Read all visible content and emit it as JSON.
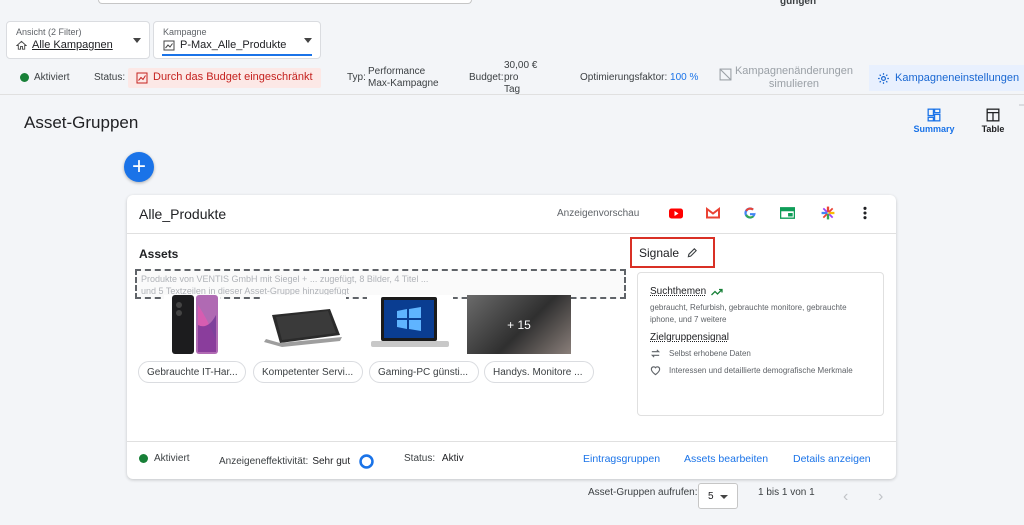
{
  "header": {
    "top_right_fragment": "gungen",
    "view_selector": {
      "label": "Ansicht (2 Filter)",
      "value": "Alle Kampagnen"
    },
    "campaign_selector": {
      "label": "Kampagne",
      "value": "P-Max_Alle_Produkte"
    }
  },
  "status_bar": {
    "state": "Aktiviert",
    "status_label": "Status:",
    "status_value": "Durch das Budget eingeschränkt",
    "type_label": "Typ:",
    "type_value_1": "Performance",
    "type_value_2": "Max-Kampagne",
    "budget_label": "Budget:",
    "budget_value_1": "30,00 €",
    "budget_value_2": "pro",
    "budget_value_3": "Tag",
    "opt_label": "Optimierungsfaktor:",
    "opt_value": "100 %",
    "simulate_1": "Kampagnenänderungen",
    "simulate_2": "simulieren",
    "settings_button": "Kampagneneinstellungen"
  },
  "page": {
    "title": "Asset-Gruppen",
    "view_summary": "Summary",
    "view_table": "Table"
  },
  "card": {
    "title": "Alle_Produkte",
    "preview_label": "Anzeigenvorschau",
    "assets_heading": "Assets",
    "assets_blurred_1": "Produkte von VENTIS GmbH mit Siegel + ... zugefügt, 8 Bilder, 4 Titel ...",
    "assets_blurred_2": "und 5 Textzeilen in dieser Asset-Gruppe hinzugefügt",
    "more_images": "+ 15",
    "chips": [
      "Gebrauchte IT-Har...",
      "Kompetenter Servi...",
      "Gaming-PC günsti...",
      "Handys. Monitore ..."
    ],
    "signals_heading": "Signale",
    "search_themes_heading": "Suchthemen",
    "search_themes_text": "gebraucht, Refurbish, gebrauchte monitore, gebrauchte iphone, und 7 weitere",
    "audience_heading": "Zielgruppensignal",
    "audience_item_1": "Selbst erhobene Daten",
    "audience_item_2": "Interessen und detaillierte demografische Merkmale",
    "footer_state": "Aktiviert",
    "effectiveness_label": "Anzeigeneffektivität:",
    "effectiveness_value": "Sehr gut",
    "footer_status_label": "Status:",
    "footer_status_value": "Aktiv",
    "link_listing": "Eintragsgruppen",
    "link_edit_assets": "Assets bearbeiten",
    "link_details": "Details anzeigen"
  },
  "pagination": {
    "label": "Asset-Gruppen aufrufen:",
    "page_size": "5",
    "range": "1 bis 1 von 1"
  },
  "colors": {
    "accent": "#1a73e8",
    "alert": "#d93025",
    "success": "#188038"
  }
}
